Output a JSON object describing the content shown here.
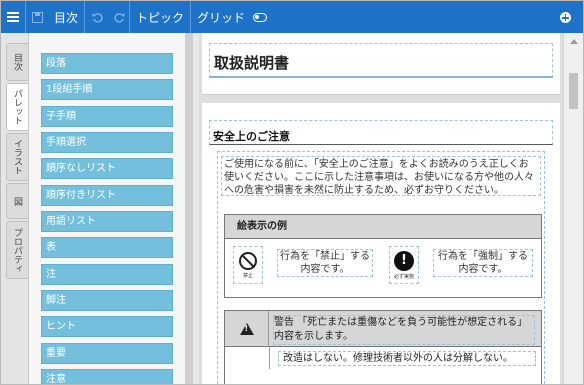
{
  "toolbar": {
    "toc_label": "目次",
    "topic_label": "トピック",
    "grid_label": "グリッド",
    "icons": [
      "menu-icon",
      "save-icon",
      "undo-icon",
      "redo-icon",
      "toggle-icon",
      "add-icon"
    ],
    "accent": "#1e72c8"
  },
  "side_tabs": [
    {
      "label": "目次",
      "active": false
    },
    {
      "label": "パレット",
      "active": true
    },
    {
      "label": "イラスト",
      "active": false
    },
    {
      "label": "図",
      "active": false
    },
    {
      "label": "プロパティ",
      "active": false
    }
  ],
  "palette": {
    "color": "#74c0dc",
    "items": [
      "段落",
      "1段組手順",
      "子手順",
      "手順選択",
      "順序なしリスト",
      "順序付きリスト",
      "用語リスト",
      "表",
      "注",
      "脚注",
      "ヒント",
      "重要",
      "注意"
    ]
  },
  "document": {
    "title": "取扱説明書",
    "section_heading": "安全上のご注意",
    "intro": "ご使用になる前に、「安全上のご注意」をよくお読みのうえ正しくお使いください。ここに示した注意事項は、お使いになる方や他の人々への危害や損害を未然に防止するため、必ずお守りください。",
    "example_heading": "絵表示の例",
    "prohibit_caption": "禁止",
    "prohibit_text": "行為を「禁止」する内容です。",
    "force_caption": "必ず実施",
    "force_text": "行為を「強制」する内容です。",
    "warning_text": "警告 「死亡または重傷などを負う可能性が想定される」内容を示します。",
    "warning_item": "改造はしない。修理技術者以外の人は分解しない。"
  }
}
